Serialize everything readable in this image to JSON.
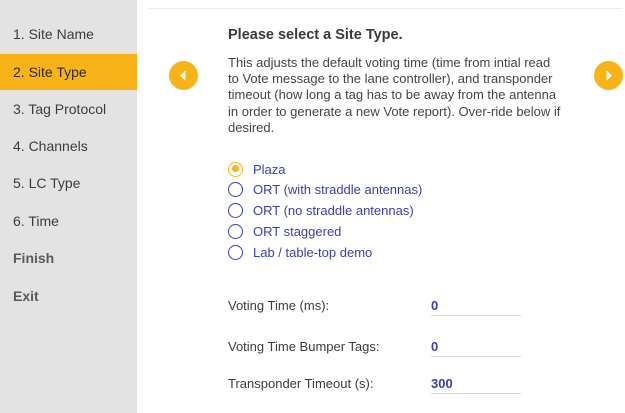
{
  "sidebar": {
    "items": [
      {
        "label": "1. Site Name"
      },
      {
        "label": "2. Site Type"
      },
      {
        "label": "3. Tag Protocol"
      },
      {
        "label": "4. Channels"
      },
      {
        "label": "5. LC Type"
      },
      {
        "label": "6. Time"
      },
      {
        "label": "Finish"
      },
      {
        "label": "Exit"
      }
    ],
    "active_item": "2. Site Type"
  },
  "main": {
    "heading": "Please select a Site Type.",
    "description": "This adjusts the default voting time (time from intial read to Vote message to the lane controller), and transponder timeout (how long a tag has to be away from the antenna in order to generate a new Vote report). Over-ride below if desired.",
    "site_types": [
      {
        "label": "Plaza",
        "selected": true
      },
      {
        "label": "ORT (with straddle antennas)",
        "selected": false
      },
      {
        "label": "ORT (no straddle antennas)",
        "selected": false
      },
      {
        "label": "ORT staggered",
        "selected": false
      },
      {
        "label": "Lab / table-top demo",
        "selected": false
      }
    ],
    "fields": {
      "voting_time": {
        "label": "Voting Time (ms):",
        "value": "0"
      },
      "voting_time_bumper": {
        "label": "Voting Time Bumper Tags:",
        "value": "0"
      },
      "transponder_timeout": {
        "label": "Transponder Timeout (s):",
        "value": "300"
      }
    }
  },
  "nav": {
    "prev_icon": "chevron-left-icon",
    "next_icon": "chevron-right-icon"
  },
  "colors": {
    "accent": "#f7b317",
    "link": "#3b3db8",
    "sidebar_bg": "#e3e3e3"
  }
}
